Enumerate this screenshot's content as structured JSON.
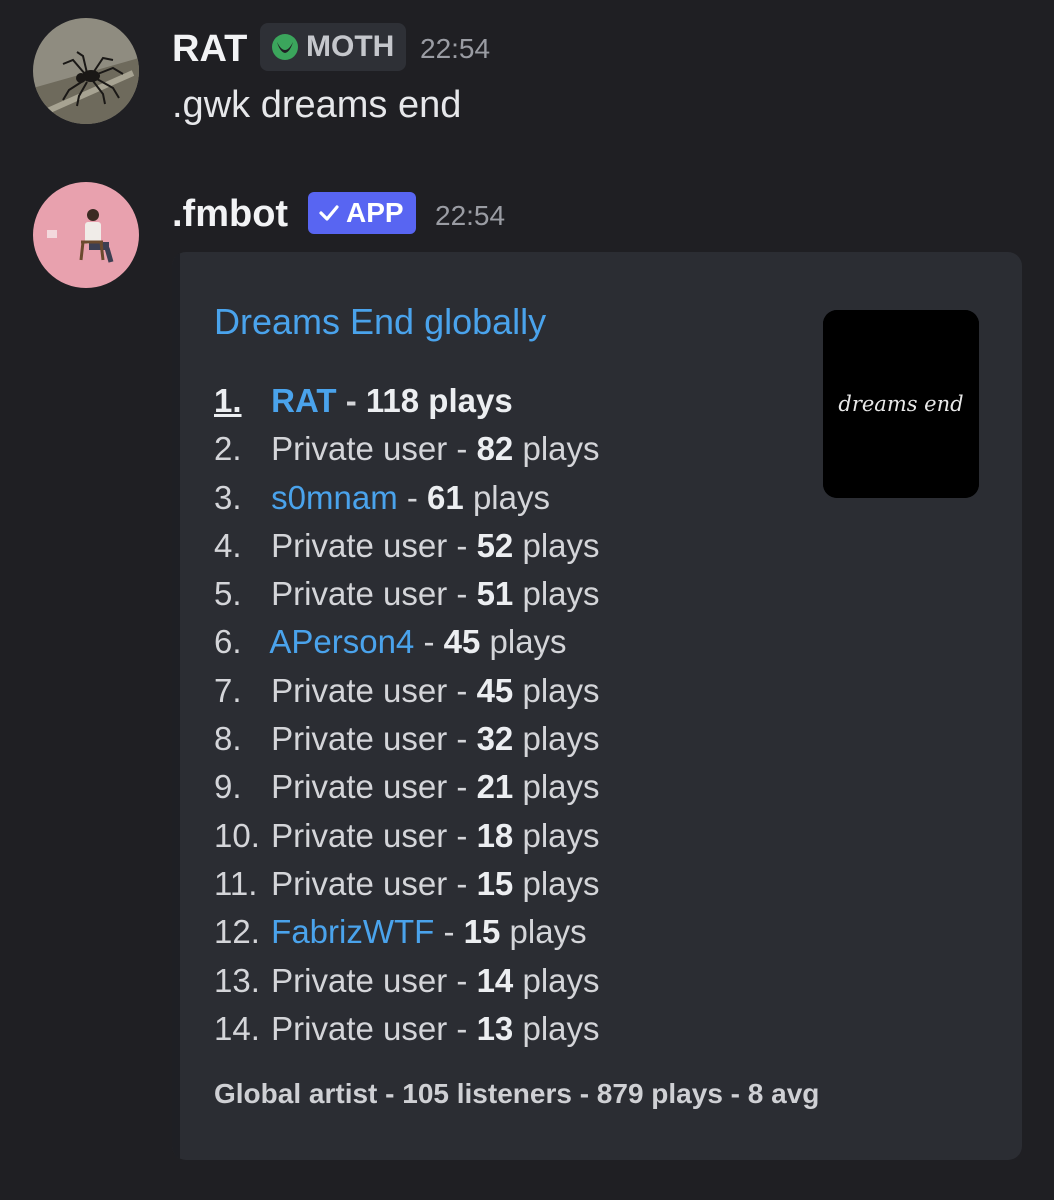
{
  "messages": [
    {
      "username": "RAT",
      "tag": "MOTH",
      "time": "22:54",
      "content": ".gwk dreams end"
    },
    {
      "username": ".fmbot",
      "badge": "APP",
      "time": "22:54"
    }
  ],
  "embed": {
    "title": "Dreams End globally",
    "thumbnail_text": "dreams end",
    "rows": [
      {
        "rank": "1.",
        "name": "RAT",
        "count": "118",
        "unit": "plays",
        "linked": true
      },
      {
        "rank": "2.",
        "name": "Private user",
        "count": "82",
        "unit": "plays",
        "linked": false
      },
      {
        "rank": "3.",
        "name": "s0mnam",
        "count": "61",
        "unit": "plays",
        "linked": true
      },
      {
        "rank": "4.",
        "name": "Private user",
        "count": "52",
        "unit": "plays",
        "linked": false
      },
      {
        "rank": "5.",
        "name": "Private user",
        "count": "51",
        "unit": "plays",
        "linked": false
      },
      {
        "rank": "6.",
        "name": "APerson4",
        "count": "45",
        "unit": "plays",
        "linked": true
      },
      {
        "rank": "7.",
        "name": "Private user",
        "count": "45",
        "unit": "plays",
        "linked": false
      },
      {
        "rank": "8.",
        "name": "Private user",
        "count": "32",
        "unit": "plays",
        "linked": false
      },
      {
        "rank": "9.",
        "name": "Private user",
        "count": "21",
        "unit": "plays",
        "linked": false
      },
      {
        "rank": "10.",
        "name": "Private user",
        "count": "18",
        "unit": "plays",
        "linked": false
      },
      {
        "rank": "11.",
        "name": "Private user",
        "count": "15",
        "unit": "plays",
        "linked": false
      },
      {
        "rank": "12.",
        "name": "FabrizWTF",
        "count": "15",
        "unit": "plays",
        "linked": true
      },
      {
        "rank": "13.",
        "name": "Private user",
        "count": "14",
        "unit": "plays",
        "linked": false
      },
      {
        "rank": "14.",
        "name": "Private user",
        "count": "13",
        "unit": "plays",
        "linked": false
      }
    ],
    "footer": "Global artist - 105 listeners - 879 plays - 8 avg"
  },
  "colors": {
    "background": "#1f1f23",
    "embed_background": "#2b2d33",
    "link": "#4aa3ec",
    "app_badge": "#5865f2"
  }
}
